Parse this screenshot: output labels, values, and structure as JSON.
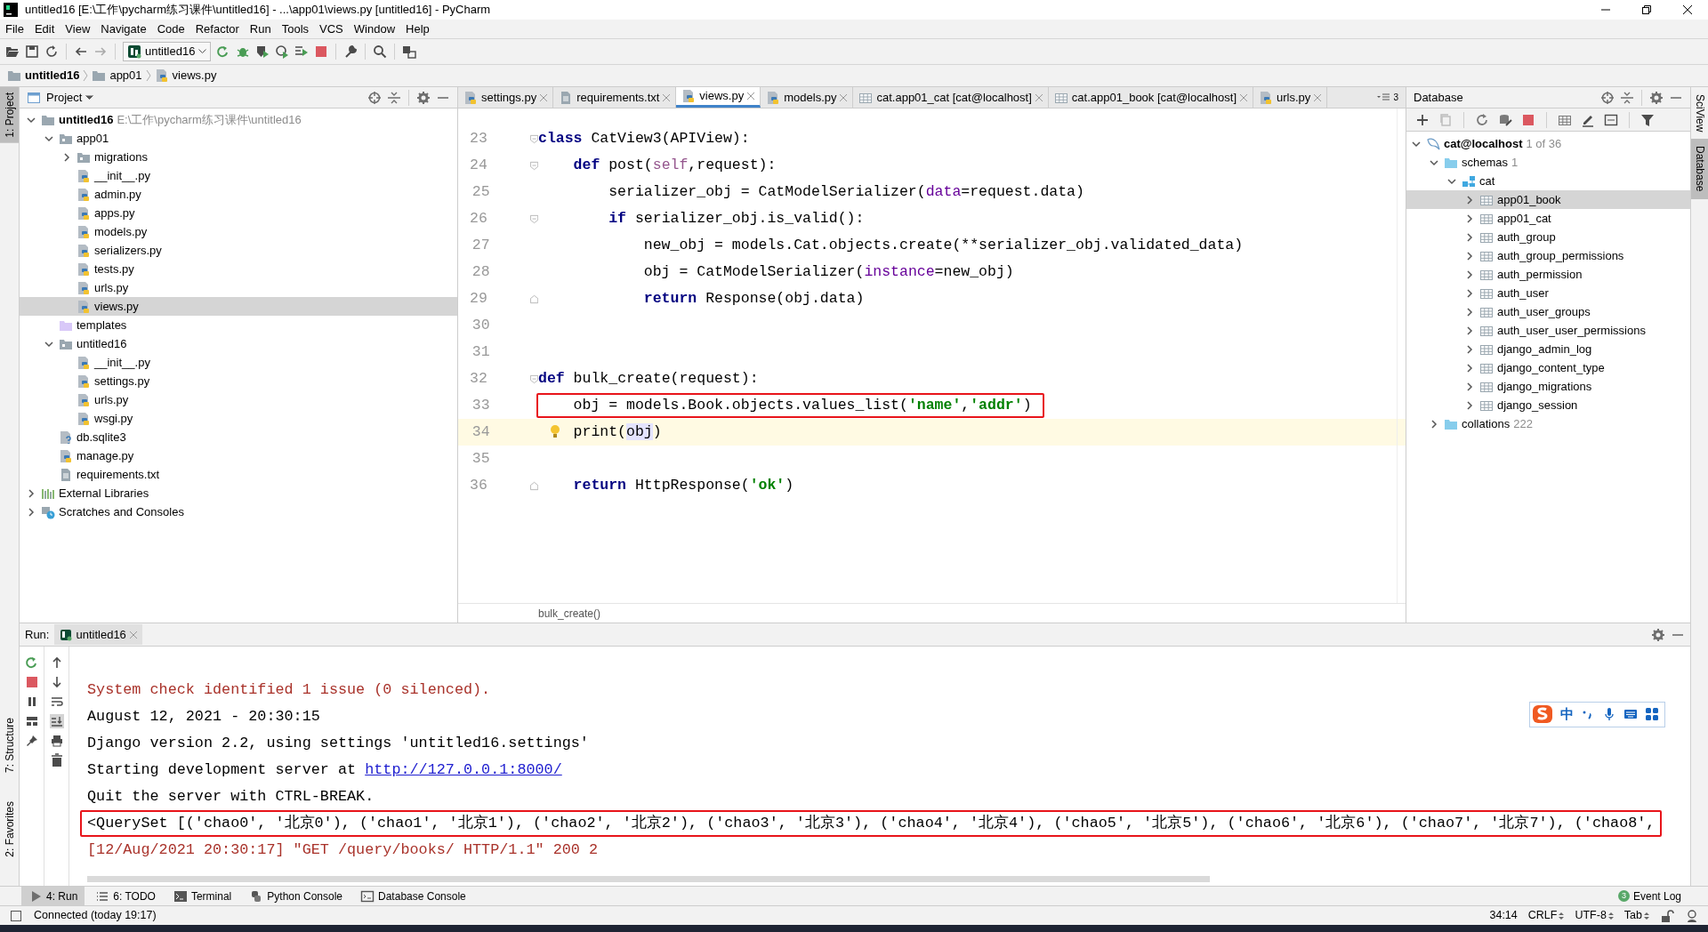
{
  "window": {
    "title": "untitled16 [E:\\工作\\pycharm练习课件\\untitled16] - ...\\app01\\views.py [untitled16] - PyCharm"
  },
  "menu": [
    "File",
    "Edit",
    "View",
    "Navigate",
    "Code",
    "Refactor",
    "Run",
    "Tools",
    "VCS",
    "Window",
    "Help"
  ],
  "run_config": {
    "label": "untitled16"
  },
  "breadcrumbs": [
    {
      "label": "untitled16",
      "kind": "folder"
    },
    {
      "label": "app01",
      "kind": "folder"
    },
    {
      "label": "views.py",
      "kind": "python"
    }
  ],
  "left_stripe": [
    {
      "label": "1: Project",
      "selected": true
    },
    {
      "label": "7: Structure",
      "selected": false
    },
    {
      "label": "2: Favorites",
      "selected": false
    }
  ],
  "project": {
    "title": "Project",
    "tree": [
      {
        "label": "untitled16",
        "hint": "E:\\工作\\pycharm练习课件\\untitled16",
        "kind": "project",
        "expanded": true,
        "selected": false,
        "children": [
          {
            "label": "app01",
            "kind": "package",
            "expanded": true,
            "selected": false,
            "children": [
              {
                "label": "migrations",
                "kind": "package",
                "expanded": false,
                "selected": false
              },
              {
                "label": "__init__.py",
                "kind": "python",
                "selected": false
              },
              {
                "label": "admin.py",
                "kind": "python",
                "selected": false
              },
              {
                "label": "apps.py",
                "kind": "python",
                "selected": false
              },
              {
                "label": "models.py",
                "kind": "python",
                "selected": false
              },
              {
                "label": "serializers.py",
                "kind": "python",
                "selected": false
              },
              {
                "label": "tests.py",
                "kind": "python",
                "selected": false
              },
              {
                "label": "urls.py",
                "kind": "python",
                "selected": false
              },
              {
                "label": "views.py",
                "kind": "python",
                "selected": true
              }
            ]
          },
          {
            "label": "templates",
            "kind": "templates",
            "selected": false
          },
          {
            "label": "untitled16",
            "kind": "package",
            "expanded": true,
            "selected": false,
            "children": [
              {
                "label": "__init__.py",
                "kind": "python",
                "selected": false
              },
              {
                "label": "settings.py",
                "kind": "python",
                "selected": false
              },
              {
                "label": "urls.py",
                "kind": "python",
                "selected": false
              },
              {
                "label": "wsgi.py",
                "kind": "python",
                "selected": false
              }
            ]
          },
          {
            "label": "db.sqlite3",
            "kind": "unknown",
            "selected": false
          },
          {
            "label": "manage.py",
            "kind": "python",
            "selected": false
          },
          {
            "label": "requirements.txt",
            "kind": "text",
            "selected": false
          }
        ]
      },
      {
        "label": "External Libraries",
        "kind": "libraries",
        "expanded": false,
        "selected": false
      },
      {
        "label": "Scratches and Consoles",
        "kind": "scratches",
        "expanded": false,
        "selected": false
      }
    ]
  },
  "editor": {
    "tabs": [
      {
        "label": "settings.py",
        "kind": "python",
        "selected": false
      },
      {
        "label": "requirements.txt",
        "kind": "text",
        "selected": false
      },
      {
        "label": "views.py",
        "kind": "python",
        "selected": true
      },
      {
        "label": "models.py",
        "kind": "python",
        "selected": false
      },
      {
        "label": "cat.app01_cat [cat@localhost]",
        "kind": "table",
        "selected": false
      },
      {
        "label": "cat.app01_book [cat@localhost]",
        "kind": "table",
        "selected": false
      },
      {
        "label": "urls.py",
        "kind": "python",
        "selected": false
      }
    ],
    "tab_overflow": "3",
    "lines": [
      {
        "number": "23",
        "fold_start": true,
        "segments": [
          {
            "kind": "keyword",
            "text": "class"
          },
          {
            "kind": "plain",
            "text": " CatView3(APIView):"
          }
        ]
      },
      {
        "number": "24",
        "fold_start": true,
        "segments": [
          {
            "kind": "keyword",
            "text": "    def"
          },
          {
            "kind": "plain",
            "text": " post("
          },
          {
            "kind": "self",
            "text": "self"
          },
          {
            "kind": "plain",
            "text": ",request):"
          }
        ]
      },
      {
        "number": "25",
        "segments": [
          {
            "kind": "plain",
            "text": "        serializer_obj = CatModelSerializer("
          },
          {
            "kind": "param",
            "text": "data"
          },
          {
            "kind": "plain",
            "text": "=request.data)"
          }
        ]
      },
      {
        "number": "26",
        "fold_start": true,
        "segments": [
          {
            "kind": "keyword",
            "text": "        if"
          },
          {
            "kind": "plain",
            "text": " serializer_obj.is_valid():"
          }
        ]
      },
      {
        "number": "27",
        "segments": [
          {
            "kind": "plain",
            "text": "            new_obj = models.Cat.objects.create(**serializer_obj.validated_data)"
          }
        ]
      },
      {
        "number": "28",
        "segments": [
          {
            "kind": "plain",
            "text": "            obj = CatModelSerializer("
          },
          {
            "kind": "param",
            "text": "instance"
          },
          {
            "kind": "plain",
            "text": "=new_obj)"
          }
        ]
      },
      {
        "number": "29",
        "fold_end": true,
        "segments": [
          {
            "kind": "keyword",
            "text": "            return"
          },
          {
            "kind": "plain",
            "text": " Response(obj.data)"
          }
        ]
      },
      {
        "number": "30"
      },
      {
        "number": "31"
      },
      {
        "number": "32",
        "fold_start": true,
        "segments": [
          {
            "kind": "keyword",
            "text": "def"
          },
          {
            "kind": "plain",
            "text": " bulk_create(request):"
          }
        ]
      },
      {
        "number": "33",
        "boxed": true,
        "segments": [
          {
            "kind": "plain",
            "text": "    obj = models.Book.objects.values_list("
          },
          {
            "kind": "string",
            "text": "'name'"
          },
          {
            "kind": "plain",
            "text": ","
          },
          {
            "kind": "string",
            "text": "'addr'"
          },
          {
            "kind": "plain",
            "text": ")"
          }
        ]
      },
      {
        "number": "34",
        "current": true,
        "segments": [
          {
            "kind": "plain",
            "text": "    print("
          },
          {
            "kind": "usage",
            "text": "obj"
          },
          {
            "kind": "plain",
            "text": ")"
          }
        ]
      },
      {
        "number": "35"
      },
      {
        "number": "36",
        "fold_end": true,
        "segments": [
          {
            "kind": "keyword",
            "text": "    return"
          },
          {
            "kind": "plain",
            "text": " HttpResponse("
          },
          {
            "kind": "string",
            "text": "'ok'"
          },
          {
            "kind": "plain",
            "text": ")"
          }
        ]
      }
    ],
    "breadcrumb": "bulk_create()"
  },
  "database": {
    "title": "Database",
    "tree": [
      {
        "label": "cat@localhost",
        "hint": "1 of 36",
        "kind": "datasource",
        "expanded": true,
        "selected": false,
        "children": [
          {
            "label": "schemas",
            "hint": "1",
            "kind": "folder",
            "expanded": true,
            "selected": false,
            "children": [
              {
                "label": "cat",
                "kind": "schema",
                "expanded": true,
                "selected": false,
                "children": [
                  {
                    "label": "app01_book",
                    "kind": "table",
                    "expanded": false,
                    "selected": true
                  },
                  {
                    "label": "app01_cat",
                    "kind": "table",
                    "expanded": false,
                    "selected": false
                  },
                  {
                    "label": "auth_group",
                    "kind": "table",
                    "expanded": false,
                    "selected": false
                  },
                  {
                    "label": "auth_group_permissions",
                    "kind": "table",
                    "expanded": false,
                    "selected": false
                  },
                  {
                    "label": "auth_permission",
                    "kind": "table",
                    "expanded": false,
                    "selected": false
                  },
                  {
                    "label": "auth_user",
                    "kind": "table",
                    "expanded": false,
                    "selected": false
                  },
                  {
                    "label": "auth_user_groups",
                    "kind": "table",
                    "expanded": false,
                    "selected": false
                  },
                  {
                    "label": "auth_user_user_permissions",
                    "kind": "table",
                    "expanded": false,
                    "selected": false
                  },
                  {
                    "label": "django_admin_log",
                    "kind": "table",
                    "expanded": false,
                    "selected": false
                  },
                  {
                    "label": "django_content_type",
                    "kind": "table",
                    "expanded": false,
                    "selected": false
                  },
                  {
                    "label": "django_migrations",
                    "kind": "table",
                    "expanded": false,
                    "selected": false
                  },
                  {
                    "label": "django_session",
                    "kind": "table",
                    "expanded": false,
                    "selected": false
                  }
                ]
              }
            ]
          },
          {
            "label": "collations",
            "hint": "222",
            "kind": "folder",
            "expanded": false,
            "selected": false
          }
        ]
      }
    ]
  },
  "right_stripe": [
    {
      "label": "SciView",
      "selected": false
    },
    {
      "label": "Database",
      "selected": true
    }
  ],
  "run": {
    "label": "Run:",
    "tab": "untitled16",
    "console": [
      {
        "kind": "error",
        "text": "System check identified 1 issue (0 silenced)."
      },
      {
        "kind": "info",
        "text": "August 12, 2021 - 20:30:15"
      },
      {
        "kind": "info",
        "text": "Django version 2.2, using settings 'untitled16.settings'"
      },
      {
        "kind": "info",
        "text": "Starting development server at ",
        "link": "http://127.0.0.1:8000/"
      },
      {
        "kind": "info",
        "text": "Quit the server with CTRL-BREAK."
      },
      {
        "kind": "info",
        "boxed": true,
        "text": "<QuerySet [('chao0', '北京0'), ('chao1', '北京1'), ('chao2', '北京2'), ('chao3', '北京3'), ('chao4', '北京4'), ('chao5', '北京5'), ('chao6', '北京6'), ('chao7', '北京7'), ('chao8',"
      },
      {
        "kind": "error",
        "text": "[12/Aug/2021 20:30:17] \"GET /query/books/ HTTP/1.1\" 200 2"
      }
    ]
  },
  "ime": {
    "label": "中"
  },
  "tool_tabs": [
    {
      "label": "4: Run",
      "kind": "run",
      "selected": true
    },
    {
      "label": "6: TODO",
      "kind": "todo",
      "selected": false
    },
    {
      "label": "Terminal",
      "kind": "terminal",
      "selected": false
    },
    {
      "label": "Python Console",
      "kind": "python",
      "selected": false
    },
    {
      "label": "Database Console",
      "kind": "db",
      "selected": false
    }
  ],
  "event_log": {
    "count": "3",
    "label": "Event Log"
  },
  "status": {
    "message": "Connected (today 19:17)",
    "position": "34:14",
    "line_separator": "CRLF",
    "encoding": "UTF-8",
    "indent": "Tab"
  }
}
